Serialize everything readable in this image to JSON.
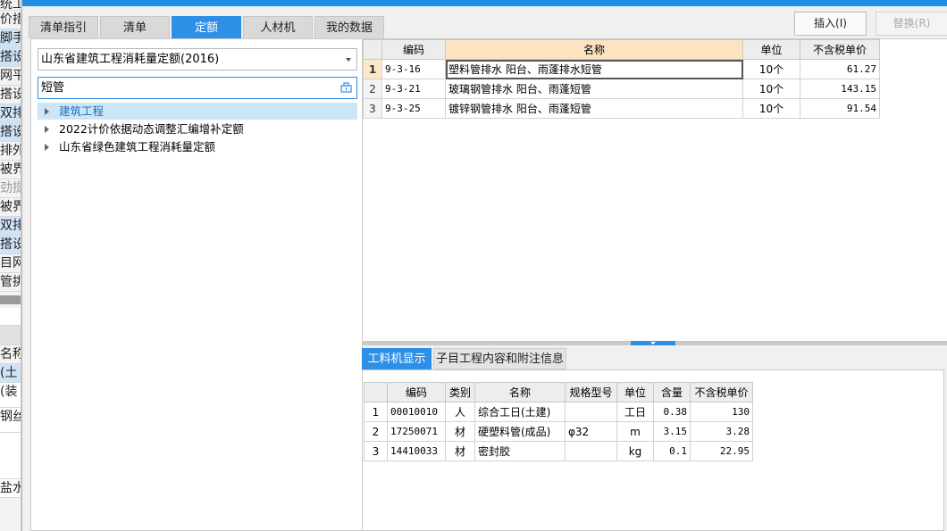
{
  "background_fragments": [
    "统工",
    "价措",
    "脚手",
    "搭设",
    "网平",
    "搭设",
    "双排",
    "搭设",
    "排外",
    "被界",
    "劲提",
    "被界",
    "双排",
    "搭设",
    "目网",
    "管挑",
    "",
    "",
    "名称",
    "(土",
    "(装",
    "钢丝",
    "",
    "盐水"
  ],
  "tabs": [
    "清单指引",
    "清单",
    "定额",
    "人材机",
    "我的数据"
  ],
  "active_tab": "定额",
  "toolbar": {
    "insert_label": "插入(I)",
    "replace_label": "替换(R)"
  },
  "library": {
    "selected": "山东省建筑工程消耗量定额(2016)"
  },
  "search": {
    "value": "短管"
  },
  "tree": [
    {
      "label": "建筑工程"
    },
    {
      "label": "2022计价依据动态调整汇编增补定额"
    },
    {
      "label": "山东省绿色建筑工程消耗量定额"
    }
  ],
  "quota_table": {
    "headers": [
      "编码",
      "名称",
      "单位",
      "不含税单价"
    ],
    "rows": [
      {
        "no": "1",
        "code": "9-3-16",
        "name": "塑料管排水 阳台、雨蓬排水短管",
        "unit": "10个",
        "price": "61.27"
      },
      {
        "no": "2",
        "code": "9-3-21",
        "name": "玻璃钢管排水 阳台、雨蓬短管",
        "unit": "10个",
        "price": "143.15"
      },
      {
        "no": "3",
        "code": "9-3-25",
        "name": "镀锌钢管排水 阳台、雨蓬短管",
        "unit": "10个",
        "price": "91.54"
      }
    ]
  },
  "bottom_tabs": [
    "工料机显示",
    "子目工程内容和附注信息"
  ],
  "resource_table": {
    "headers": [
      "编码",
      "类别",
      "名称",
      "规格型号",
      "单位",
      "含量",
      "不含税单价"
    ],
    "rows": [
      {
        "no": "1",
        "code": "00010010",
        "type": "人",
        "name": "综合工日(土建)",
        "spec": "",
        "unit": "工日",
        "qty": "0.38",
        "price": "130"
      },
      {
        "no": "2",
        "code": "17250071",
        "type": "材",
        "name": "硬塑料管(成品)",
        "spec": "φ32",
        "unit": "m",
        "qty": "3.15",
        "price": "3.28"
      },
      {
        "no": "3",
        "code": "14410033",
        "type": "材",
        "name": "密封胶",
        "spec": "",
        "unit": "kg",
        "qty": "0.1",
        "price": "22.95"
      }
    ]
  },
  "colors": {
    "accent": "#2e8fe6",
    "selected_row": "#cde6f7",
    "header_highlight": "#fde3c1"
  }
}
